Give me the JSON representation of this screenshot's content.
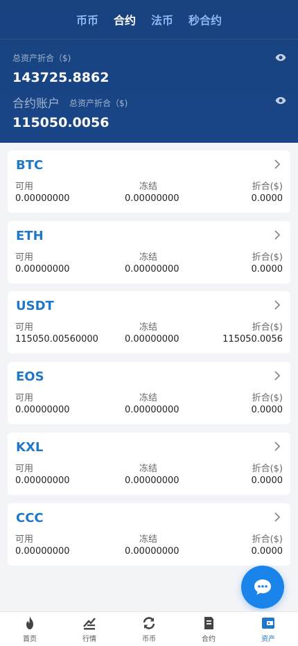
{
  "tabs": [
    {
      "label": "币币"
    },
    {
      "label": "合约"
    },
    {
      "label": "法币"
    },
    {
      "label": "秒合约"
    }
  ],
  "summary": {
    "total_label": "总资产折合（$)",
    "total_value": "143725.8862",
    "account_title": "合约账户",
    "account_total_label": "总资产折合（$)",
    "account_value": "115050.0056"
  },
  "column_labels": {
    "available": "可用",
    "frozen": "冻结",
    "converted": "折合($)"
  },
  "assets": [
    {
      "coin": "BTC",
      "available": "0.00000000",
      "frozen": "0.00000000",
      "converted": "0.0000"
    },
    {
      "coin": "ETH",
      "available": "0.00000000",
      "frozen": "0.00000000",
      "converted": "0.0000"
    },
    {
      "coin": "USDT",
      "available": "115050.00560000",
      "frozen": "0.00000000",
      "converted": "115050.0056"
    },
    {
      "coin": "EOS",
      "available": "0.00000000",
      "frozen": "0.00000000",
      "converted": "0.0000"
    },
    {
      "coin": "KXL",
      "available": "0.00000000",
      "frozen": "0.00000000",
      "converted": "0.0000"
    },
    {
      "coin": "CCC",
      "available": "0.00000000",
      "frozen": "0.00000000",
      "converted": "0.0000"
    }
  ],
  "bottom_nav": [
    {
      "label": "首页",
      "icon": "fire-icon"
    },
    {
      "label": "行情",
      "icon": "chart-icon"
    },
    {
      "label": "币币",
      "icon": "refresh-icon"
    },
    {
      "label": "合约",
      "icon": "document-icon"
    },
    {
      "label": "资产",
      "icon": "wallet-icon"
    }
  ],
  "colors": {
    "header_bg": "#17427e",
    "accent": "#1f77c9",
    "fab": "#1a84ea",
    "page_bg": "#f3f4f8"
  }
}
